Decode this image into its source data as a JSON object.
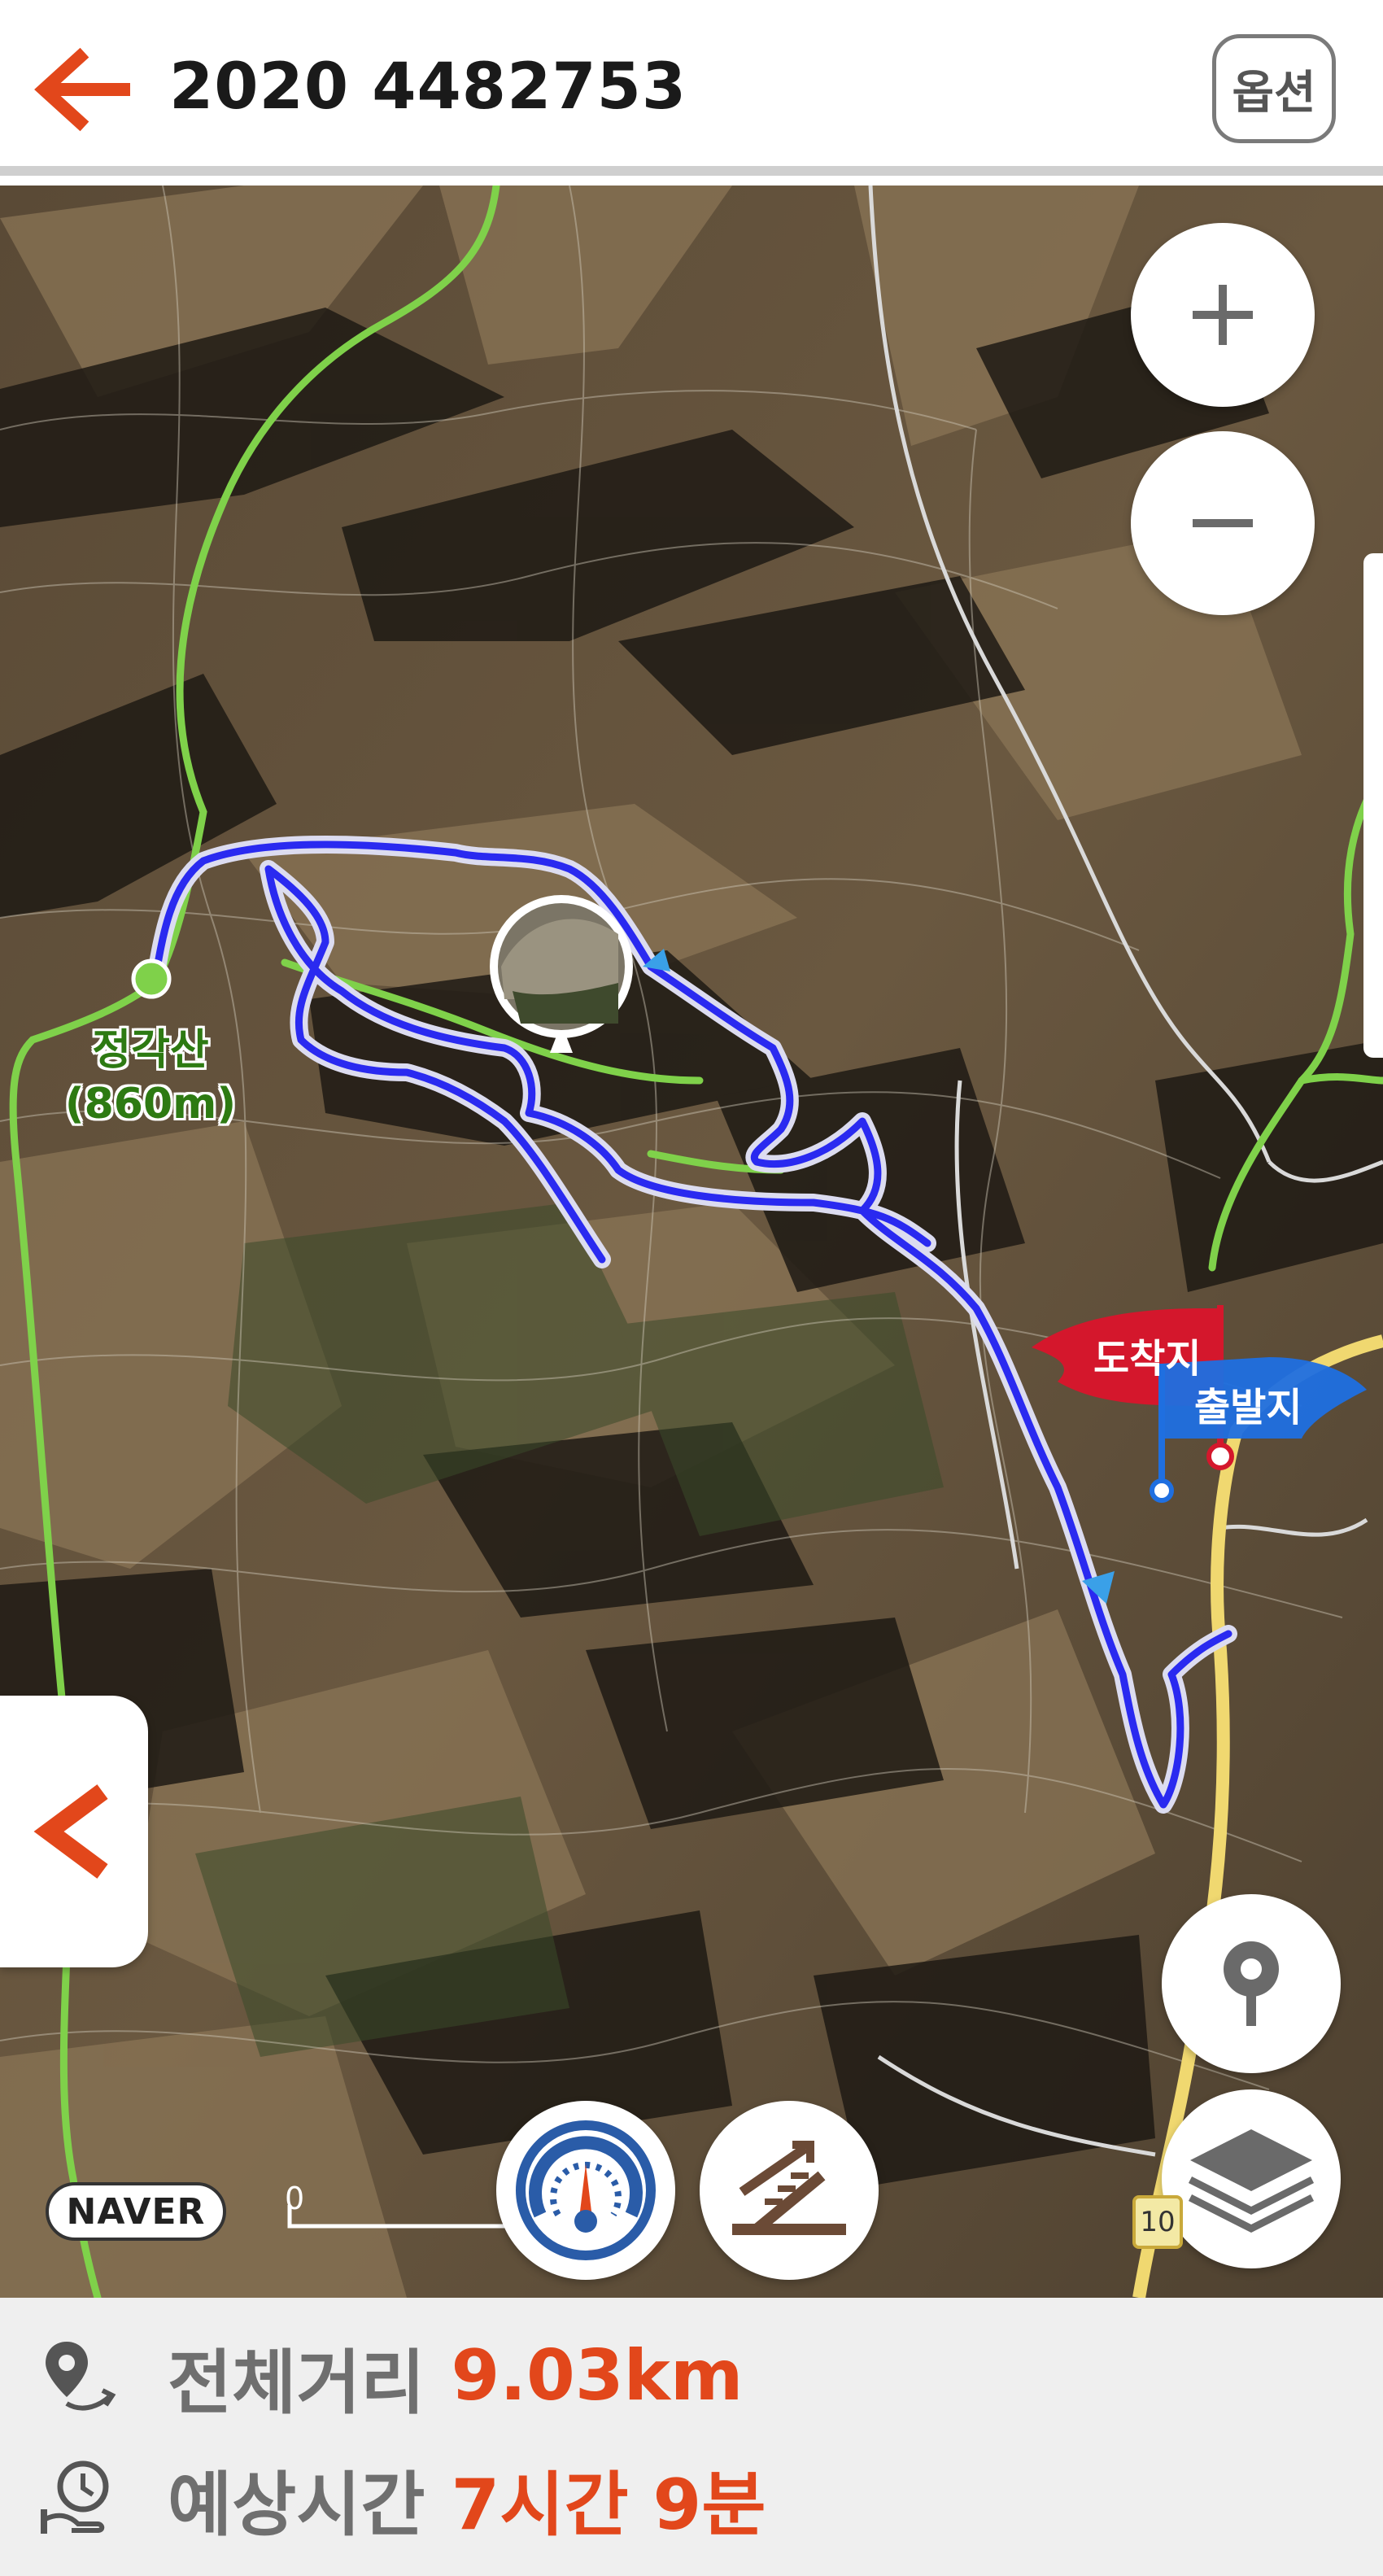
{
  "header": {
    "title": "2020 4482753",
    "options_label": "옵션"
  },
  "map": {
    "peak_name": "정각산",
    "peak_elevation": "(860m)",
    "arrival_flag": "도착지",
    "departure_flag": "출발지",
    "provider_logo": "NAVER",
    "scale_zero": "0",
    "road_badge": "10",
    "icons": {
      "zoom_in": "plus-icon",
      "zoom_out": "minus-icon",
      "location": "map-pin-icon",
      "layers": "layers-icon",
      "speed": "speedometer-icon",
      "slope": "slope-icon",
      "side_panel": "chevron-left-icon"
    },
    "colors": {
      "route": "#2a2af0",
      "trail": "#7fd14a",
      "arrival_flag": "#d4172c",
      "departure_flag": "#1f6fe0",
      "accent": "#e2471b"
    }
  },
  "footer": {
    "distance_label": "전체거리",
    "distance_value": "9.03km",
    "time_label": "예상시간",
    "time_value": "7시간 9분"
  }
}
